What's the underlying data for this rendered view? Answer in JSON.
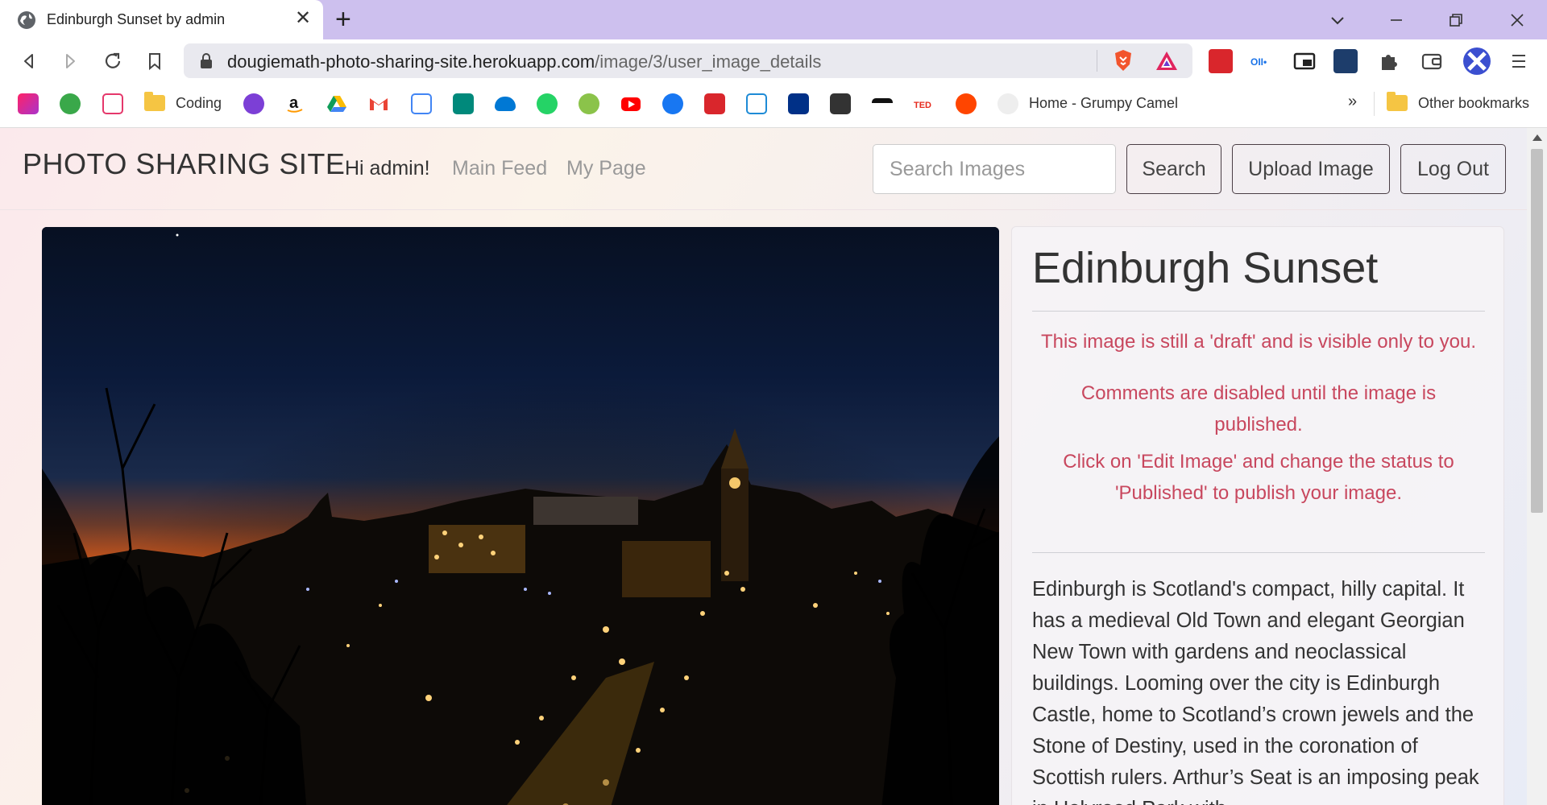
{
  "browser": {
    "tab_title": "Edinburgh Sunset by admin",
    "url_host": "dougiemath-photo-sharing-site.herokuapp.com",
    "url_path": "/image/3/user_image_details",
    "tab_close_glyph": "✕",
    "new_tab_glyph": "+",
    "bookmarks": {
      "coding_label": "Coding",
      "grumpy_label": "Home - Grumpy Camel",
      "other_label": "Other bookmarks",
      "overflow_glyph": "»"
    }
  },
  "site": {
    "brand": "PHOTO SHARING SITE",
    "greeting": "Hi admin!",
    "main_feed": "Main Feed",
    "my_page": "My Page",
    "search_placeholder": "Search Images",
    "search_button": "Search",
    "upload_button": "Upload Image",
    "logout_button": "Log Out"
  },
  "image_details": {
    "title": "Edinburgh Sunset",
    "draft_notice": "This image is still a 'draft' and is visible only to you.",
    "comments_notice": "Comments are disabled until the image is published.",
    "publish_notice": "Click on 'Edit Image' and change the status to 'Published' to publish your image.",
    "description": "Edinburgh is Scotland's compact, hilly capital. It has a medieval Old Town and elegant Georgian New Town with gardens and neoclassical buildings. Looming over the city is Edinburgh Castle, home to Scotland’s crown jewels and the Stone of Destiny, used in the coronation of Scottish rulers. Arthur’s Seat is an imposing peak in Holyrood Park with"
  },
  "colors": {
    "tabbar": "#cdc0ee",
    "warning_text": "#c8475e",
    "accent_dark": "#333333"
  }
}
